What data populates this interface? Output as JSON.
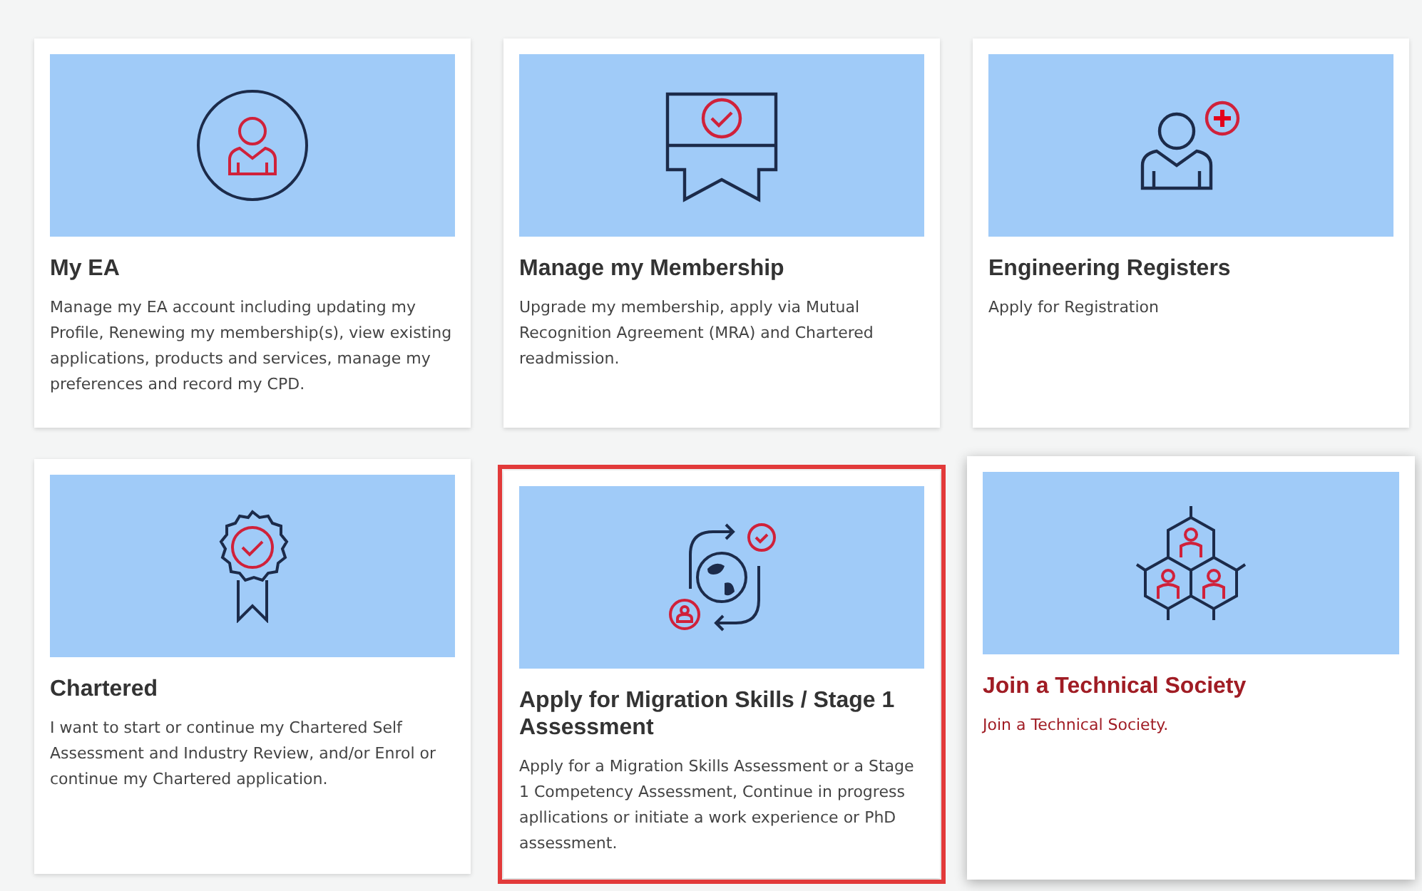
{
  "cards": [
    {
      "kind": "person",
      "title": "My EA",
      "description": "Manage my EA account including updating my Profile, Renewing my membership(s), view existing applications, products and services, manage my preferences and record my CPD.",
      "highlighted": false,
      "hovered": false
    },
    {
      "kind": "certificate",
      "title": "Manage my Membership",
      "description": "Upgrade my membership, apply via Mutual Recognition Agreement (MRA) and Chartered readmission.",
      "highlighted": false,
      "hovered": false
    },
    {
      "kind": "registration",
      "title": "Engineering Registers",
      "description": "Apply for Registration",
      "highlighted": false,
      "hovered": false
    },
    {
      "kind": "rosette",
      "title": "Chartered",
      "description": "I want to start or continue my Chartered Self Assessment and Industry Review, and/or Enrol or continue my Chartered application.",
      "highlighted": false,
      "hovered": false
    },
    {
      "kind": "migration",
      "title": "Apply for Migration Skills / Stage 1 Assessment",
      "description": "Apply for a Migration Skills Assessment or a Stage 1 Competency Assessment, Continue in progress apllications or initiate a work experience or PhD assessment.",
      "highlighted": true,
      "hovered": false
    },
    {
      "kind": "society",
      "title": "Join a Technical Society",
      "description": "Join a Technical Society.",
      "highlighted": false,
      "hovered": true
    }
  ]
}
